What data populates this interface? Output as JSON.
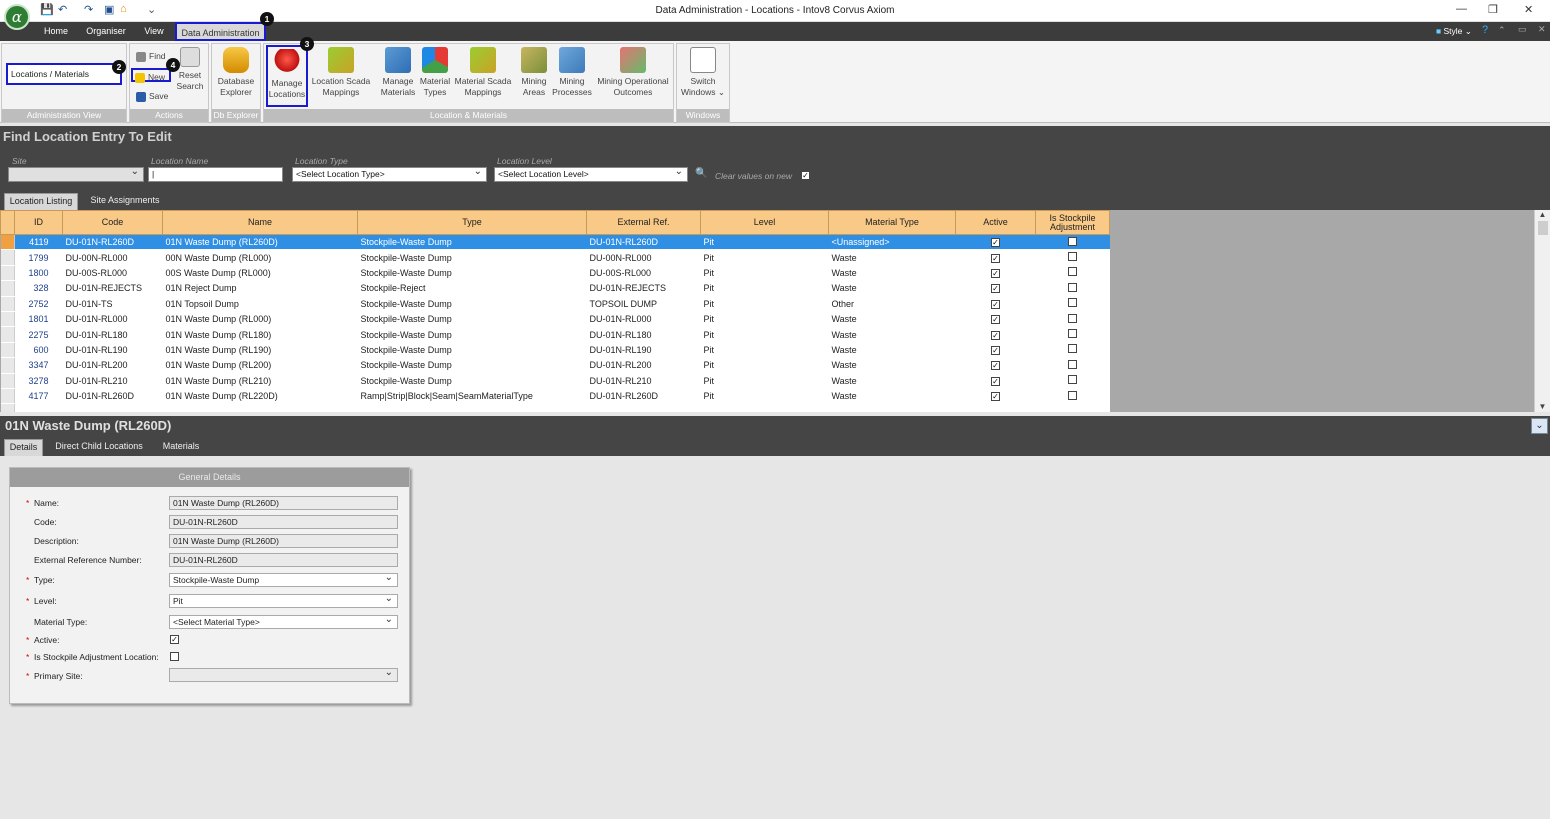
{
  "window": {
    "title": "Data Administration - Locations - Intov8 Corvus Axiom",
    "style_label": "Style",
    "logo_text": "α"
  },
  "menu": [
    "Home",
    "Organiser",
    "View",
    "Data Administration"
  ],
  "ribbon": {
    "admin_view": {
      "value": "Locations / Materials",
      "caption": "Administration View"
    },
    "actions": {
      "find": "Find",
      "new": "New",
      "save": "Save",
      "reset": "Reset",
      "search": "Search",
      "caption": "Actions"
    },
    "db": {
      "label1": "Database",
      "label2": "Explorer",
      "caption": "Db Explorer"
    },
    "locmat": {
      "caption": "Location & Materials",
      "buttons": [
        {
          "l1": "Manage",
          "l2": "Locations"
        },
        {
          "l1": "Location Scada",
          "l2": "Mappings"
        },
        {
          "l1": "Manage",
          "l2": "Materials"
        },
        {
          "l1": "Material",
          "l2": "Types"
        },
        {
          "l1": "Material Scada",
          "l2": "Mappings"
        },
        {
          "l1": "Mining",
          "l2": "Areas"
        },
        {
          "l1": "Mining",
          "l2": "Processes"
        },
        {
          "l1": "Mining Operational",
          "l2": "Outcomes"
        }
      ]
    },
    "windows": {
      "l1": "Switch",
      "l2": "Windows",
      "caption": "Windows"
    }
  },
  "badges": [
    "1",
    "2",
    "3",
    "4"
  ],
  "find": {
    "title": "Find Location Entry To Edit",
    "site_label": "Site",
    "name_label": "Location Name",
    "type_label": "Location Type",
    "type_value": "<Select Location Type>",
    "level_label": "Location Level",
    "level_value": "<Select Location Level>",
    "clear_label": "Clear values on new"
  },
  "tabs": [
    "Location Listing",
    "Site Assignments"
  ],
  "grid": {
    "columns": [
      "ID",
      "Code",
      "Name",
      "Type",
      "External Ref.",
      "Level",
      "Material Type",
      "Active",
      "Is Stockpile Adjustment"
    ],
    "rows": [
      [
        "4119",
        "DU-01N-RL260D",
        "01N Waste Dump (RL260D)",
        "Stockpile-Waste Dump",
        "DU-01N-RL260D",
        "Pit",
        "<Unassigned>"
      ],
      [
        "1799",
        "DU-00N-RL000",
        "00N Waste Dump (RL000)",
        "Stockpile-Waste Dump",
        "DU-00N-RL000",
        "Pit",
        "Waste"
      ],
      [
        "1800",
        "DU-00S-RL000",
        "00S Waste Dump (RL000)",
        "Stockpile-Waste Dump",
        "DU-00S-RL000",
        "Pit",
        "Waste"
      ],
      [
        "328",
        "DU-01N-REJECTS",
        "01N Reject Dump",
        "Stockpile-Reject",
        "DU-01N-REJECTS",
        "Pit",
        "Waste"
      ],
      [
        "2752",
        "DU-01N-TS",
        "01N Topsoil Dump",
        "Stockpile-Waste Dump",
        "TOPSOIL DUMP",
        "Pit",
        "Other"
      ],
      [
        "1801",
        "DU-01N-RL000",
        "01N Waste Dump (RL000)",
        "Stockpile-Waste Dump",
        "DU-01N-RL000",
        "Pit",
        "Waste"
      ],
      [
        "2275",
        "DU-01N-RL180",
        "01N Waste Dump (RL180)",
        "Stockpile-Waste Dump",
        "DU-01N-RL180",
        "Pit",
        "Waste"
      ],
      [
        "600",
        "DU-01N-RL190",
        "01N Waste Dump (RL190)",
        "Stockpile-Waste Dump",
        "DU-01N-RL190",
        "Pit",
        "Waste"
      ],
      [
        "3347",
        "DU-01N-RL200",
        "01N Waste Dump (RL200)",
        "Stockpile-Waste Dump",
        "DU-01N-RL200",
        "Pit",
        "Waste"
      ],
      [
        "3278",
        "DU-01N-RL210",
        "01N Waste Dump (RL210)",
        "Stockpile-Waste Dump",
        "DU-01N-RL210",
        "Pit",
        "Waste"
      ],
      [
        "4177",
        "DU-01N-RL260D",
        "01N Waste Dump (RL220D)",
        "Ramp|Strip|Block|Seam|SeamMaterialType",
        "DU-01N-RL260D",
        "Pit",
        "Waste"
      ]
    ]
  },
  "detail": {
    "title": "01N Waste Dump (RL260D)",
    "tabs": [
      "Details",
      "Direct Child Locations",
      "Materials"
    ],
    "panel_title": "General Details",
    "labels": [
      "Name:",
      "Code:",
      "Description:",
      "External Reference Number:",
      "Type:",
      "Level:",
      "Material Type:",
      "Active:",
      "Is Stockpile Adjustment Location:",
      "Primary Site:"
    ],
    "values": {
      "name": "01N Waste Dump (RL260D)",
      "code": "DU-01N-RL260D",
      "description": "01N Waste Dump (RL260D)",
      "extref": "DU-01N-RL260D",
      "type": "Stockpile-Waste Dump",
      "level": "Pit",
      "material": "<Select Material Type>"
    }
  }
}
